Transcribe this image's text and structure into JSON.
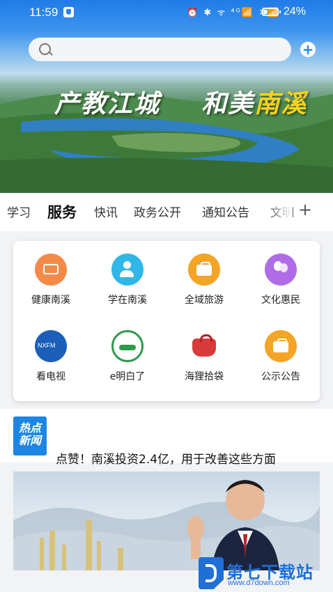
{
  "status_bar": {
    "time": "11:59",
    "indicators": "⏰ ✱ ᯤ ⁴ᴳ📶 ✕📶",
    "battery": "24%"
  },
  "search": {
    "placeholder": ""
  },
  "banner": {
    "slogan_part1": "产教江城",
    "slogan_part2a": "和美",
    "slogan_part2b": "南溪"
  },
  "tabs": [
    {
      "label": "学习"
    },
    {
      "label": "服务",
      "active": true
    },
    {
      "label": "快讯"
    },
    {
      "label": "政务公开"
    },
    {
      "label": "通知公告"
    },
    {
      "label": "文明"
    }
  ],
  "tab_add": "+",
  "services": [
    {
      "label": "健康南溪",
      "icon": "id-card-icon",
      "color": "#f48a4a"
    },
    {
      "label": "学在南溪",
      "icon": "pen-user-icon",
      "color": "#2fb7e8"
    },
    {
      "label": "全域旅游",
      "icon": "briefcase-icon",
      "color": "#f4a426"
    },
    {
      "label": "文化惠民",
      "icon": "balloon-icon",
      "color": "#b06ce6"
    },
    {
      "label": "看电视",
      "icon": "nxfm-tv-icon",
      "color": "#1b5fb8",
      "badge": "NXFM"
    },
    {
      "label": "e明白了",
      "icon": "e-leaf-icon",
      "color": "#2f9a4a"
    },
    {
      "label": "海狸拾袋",
      "icon": "red-bag-icon",
      "color": "#d93b3b"
    },
    {
      "label": "公示公告",
      "icon": "notice-icon",
      "color": "#f4a426"
    }
  ],
  "news": {
    "logo_line1": "热点",
    "logo_line2": "新闻",
    "ticker": "…",
    "headline": "点赞！南溪投资2.4亿，用于改善这些方面"
  },
  "watermark": {
    "title": "第七下载站",
    "url": "www.d7down.com"
  }
}
